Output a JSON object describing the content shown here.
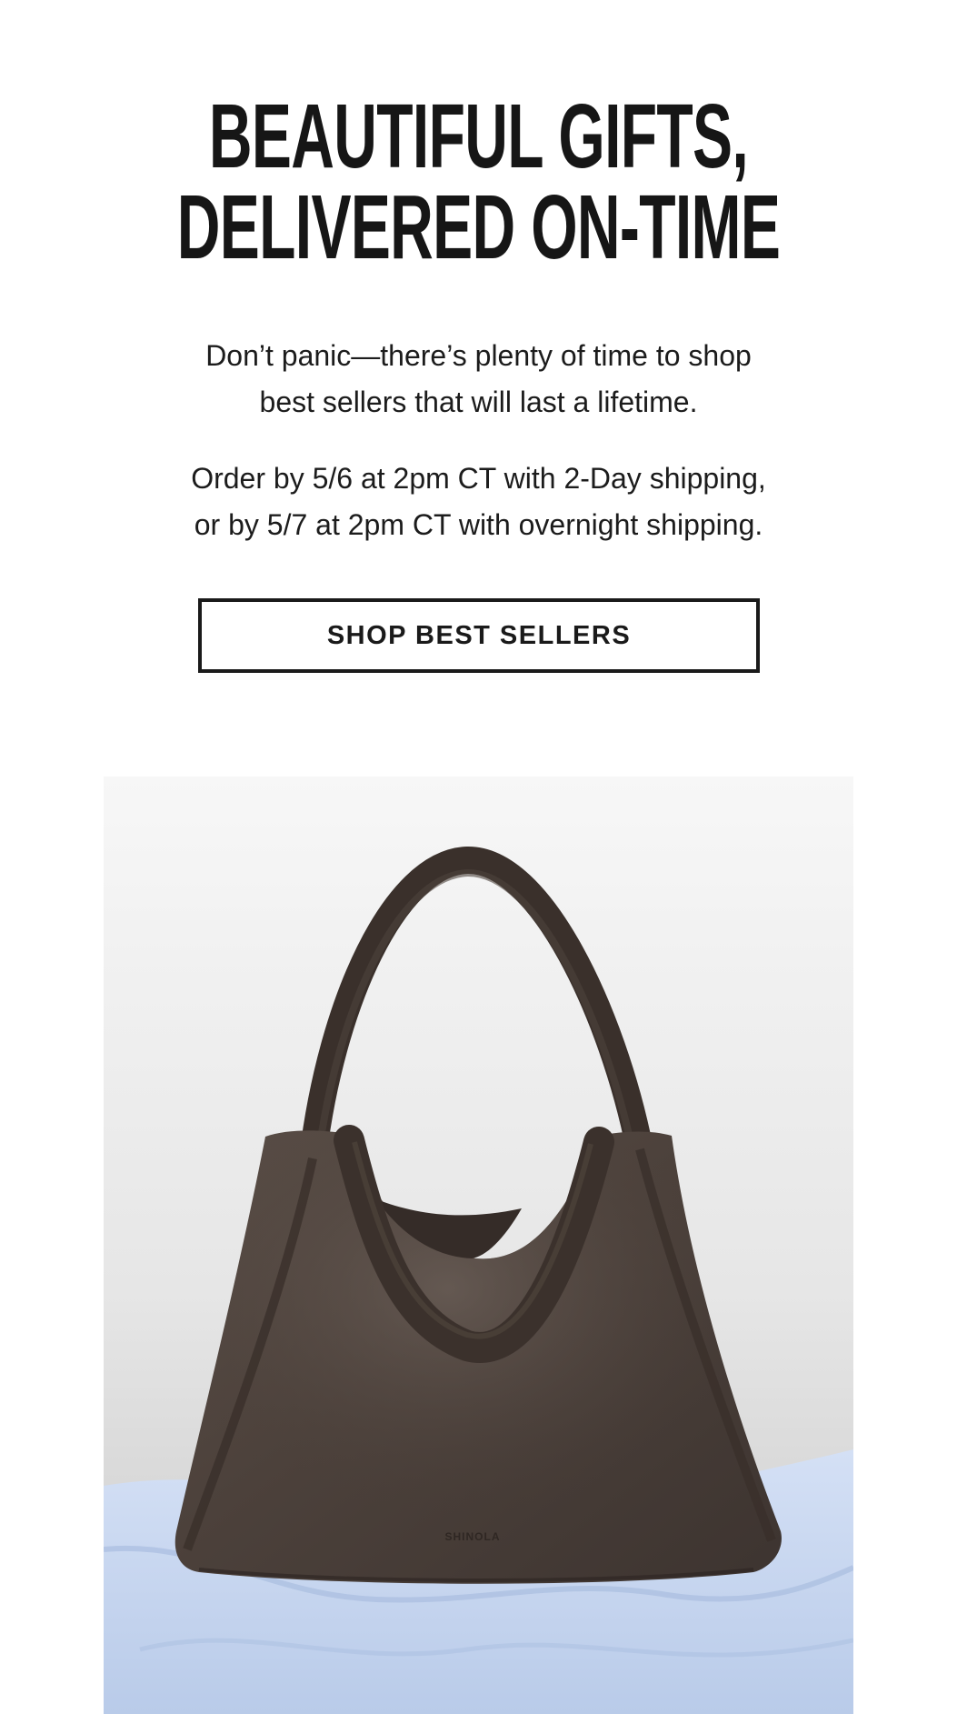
{
  "hero": {
    "headline_line1": "BEAUTIFUL GIFTS,",
    "headline_line2": "DELIVERED ON-TIME",
    "intro_line1": "Don’t panic—there’s plenty of time to shop",
    "intro_line2": "best sellers that will last a lifetime.",
    "shipping_line1": "Order by 5/6 at 2pm CT with 2-Day shipping,",
    "shipping_line2": "or by 5/7 at 2pm CT with overnight shipping."
  },
  "cta": {
    "label": "SHOP BEST SELLERS"
  },
  "product": {
    "image": "leather-tote-bag-photo",
    "brand_stamp": "SHINOLA"
  },
  "colors": {
    "text": "#1c1c1c",
    "button_border": "#1a1a1a",
    "bag_leather": "#4a3f39",
    "backdrop_cloth": "#c7d6ee"
  }
}
